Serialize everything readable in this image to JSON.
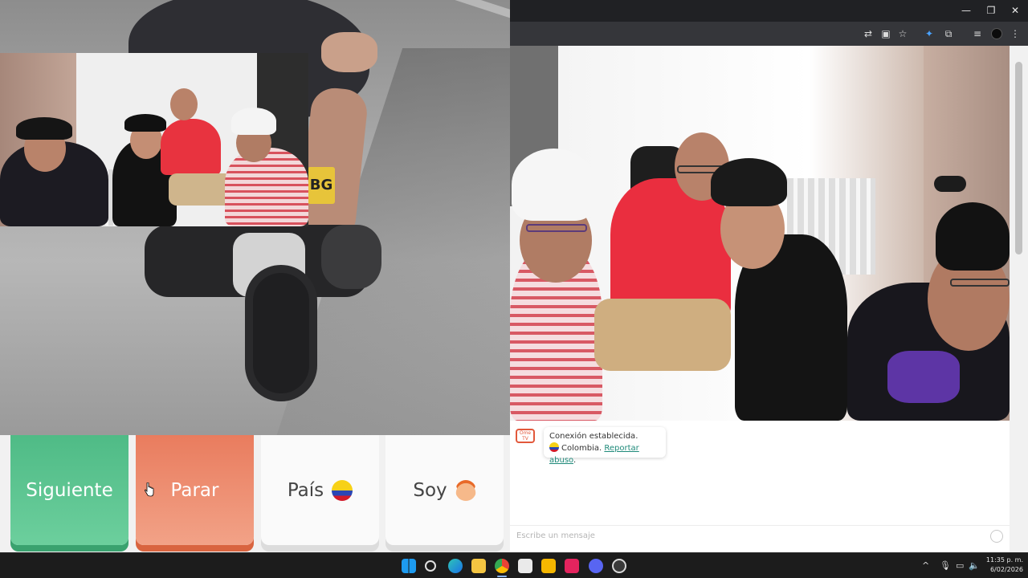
{
  "buttons": {
    "next_label": "Siguiente",
    "stop_label": "Parar",
    "country_label": "País",
    "me_label": "Soy"
  },
  "video": {
    "plate_text": "BG"
  },
  "browser": {
    "minimize": "—",
    "restore": "❐",
    "close": "✕",
    "toolbar_icons": [
      "translate-icon",
      "screenshot-icon",
      "bookmark-star-icon",
      "extension-puzzle-icon",
      "extensions-icon",
      "reading-list-icon",
      "profile-avatar",
      "menu-icon"
    ]
  },
  "chat": {
    "logo_text": "Ome TV",
    "status_line": "Conexión establecida.",
    "country": "Colombia.",
    "report_link": "Reportar abuso",
    "report_suffix": ".",
    "input_placeholder": "Escribe un mensaje"
  },
  "taskbar": {
    "time": "11:35 p. m.",
    "date": "6/02/2026",
    "tray_chevron": "^"
  },
  "colors": {
    "next": "#5cc592",
    "stop": "#ee8e70",
    "link": "#1f8a7a",
    "taskbar": "#1c1c1c"
  }
}
